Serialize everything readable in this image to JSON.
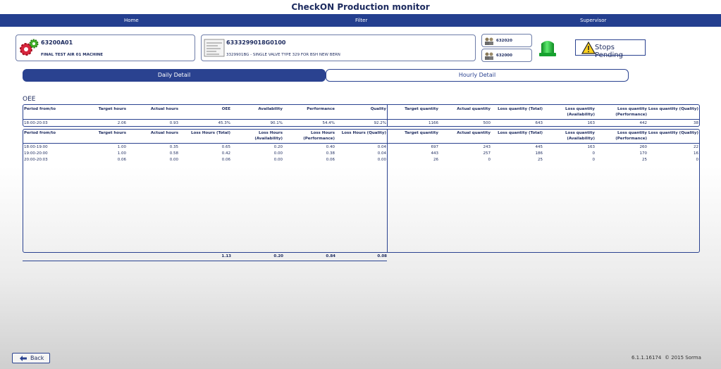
{
  "app": {
    "title": "CheckON Production monitor"
  },
  "nav": {
    "home": "Home",
    "filter": "Filter",
    "supervisor": "Supervisor"
  },
  "machine": {
    "code": "63200A01",
    "name": "FINAL TEST AIR 01 MACHINE"
  },
  "product": {
    "code": "6333299018G0100",
    "description": "3329901BG - SINGLE VALVE TYPE 329 FOR BSH NEW BERN"
  },
  "operators": [
    {
      "id": "632020"
    },
    {
      "id": "632000"
    }
  ],
  "stops": {
    "label": "Stops Pending"
  },
  "tabs": {
    "daily": "Daily Detail",
    "hourly": "Hourly Detail"
  },
  "oee_section": {
    "label": "OEE",
    "headers": {
      "period": "Period from/to",
      "target_hours": "Target hours",
      "actual_hours": "Actual hours",
      "oee": "OEE",
      "availability": "Availability",
      "performance": "Performance",
      "quality": "Quality",
      "target_qty": "Target quantity",
      "actual_qty": "Actual quantity",
      "loss_total": "Loss quantity (Total)",
      "loss_avail_1": "Loss quantity",
      "loss_avail_2": "(Availability)",
      "loss_perf_1": "Loss quantity",
      "loss_perf_2": "(Performance)",
      "loss_quality": "Loss quantity (Quality)"
    },
    "row": {
      "period": "18:00-20:03",
      "target_hours": "2.06",
      "actual_hours": "0.93",
      "oee": "45.3%",
      "availability": "90.1%",
      "performance": "54.4%",
      "quality": "92.2%",
      "target_qty": "1166",
      "actual_qty": "500",
      "loss_total": "643",
      "loss_avail": "163",
      "loss_perf": "442",
      "loss_quality": "38"
    }
  },
  "detail": {
    "headers": {
      "period": "Period from/to",
      "target_hours": "Target hours",
      "actual_hours": "Actual hours",
      "loss_hours_total": "Loss Hours (Total)",
      "loss_hours_avail_1": "Loss Hours",
      "loss_hours_avail_2": "(Availability)",
      "loss_hours_perf_1": "Loss Hours",
      "loss_hours_perf_2": "(Performance)",
      "loss_hours_quality": "Loss Hours (Quality)",
      "target_qty": "Target quantity",
      "actual_qty": "Actual quantity",
      "loss_total": "Loss quantity (Total)",
      "loss_avail_1": "Loss quantity",
      "loss_avail_2": "(Availability)",
      "loss_perf_1": "Loss quantity",
      "loss_perf_2": "(Performance)",
      "loss_quality": "Loss quantity (Quality)"
    },
    "rows": [
      {
        "period": "18:00-19:00",
        "target_hours": "1.00",
        "actual_hours": "0.35",
        "lh_total": "0.65",
        "lh_avail": "0.20",
        "lh_perf": "0.40",
        "lh_quality": "0.04",
        "target_qty": "697",
        "actual_qty": "243",
        "lq_total": "445",
        "lq_avail": "163",
        "lq_perf": "260",
        "lq_quality": "22"
      },
      {
        "period": "19:00-20:00",
        "target_hours": "1.00",
        "actual_hours": "0.58",
        "lh_total": "0.42",
        "lh_avail": "0.00",
        "lh_perf": "0.38",
        "lh_quality": "0.04",
        "target_qty": "443",
        "actual_qty": "257",
        "lq_total": "186",
        "lq_avail": "0",
        "lq_perf": "170",
        "lq_quality": "16"
      },
      {
        "period": "20:00-20:03",
        "target_hours": "0.06",
        "actual_hours": "0.00",
        "lh_total": "0.06",
        "lh_avail": "0.00",
        "lh_perf": "0.06",
        "lh_quality": "0.00",
        "target_qty": "26",
        "actual_qty": "0",
        "lq_total": "25",
        "lq_avail": "0",
        "lq_perf": "25",
        "lq_quality": "0"
      }
    ],
    "totals": {
      "lh_total": "1.13",
      "lh_avail": "0.20",
      "lh_perf": "0.84",
      "lh_quality": "0.08"
    }
  },
  "footer": {
    "back": "Back",
    "version": "6.1.1.16174",
    "copyright": "© 2015 Sorma"
  },
  "colors": {
    "navbar": "#243f8f",
    "accent": "#2a4290",
    "beacon": "#1fbf3a"
  }
}
